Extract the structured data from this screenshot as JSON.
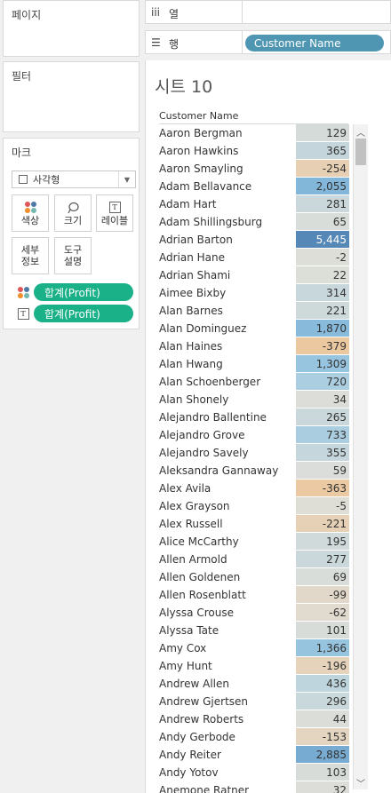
{
  "panels": {
    "pages": "페이지",
    "filters": "필터",
    "marks": "마크"
  },
  "marks_card": {
    "mark_type": "사각형",
    "buttons": {
      "color": "색상",
      "size": "크기",
      "label": "레이블",
      "detail": "세부\n정보",
      "tooltip": "도구\n설명"
    },
    "fields": [
      "합계(Profit)",
      "합계(Profit)"
    ]
  },
  "shelves": {
    "columns_label": "열",
    "rows_label": "행",
    "rows_pill": "Customer Name"
  },
  "sheet": {
    "title": "시트 10",
    "column_header": "Customer Name",
    "rows": [
      {
        "name": "Aaron Bergman",
        "value": "129"
      },
      {
        "name": "Aaron Hawkins",
        "value": "365"
      },
      {
        "name": "Aaron Smayling",
        "value": "-254"
      },
      {
        "name": "Adam Bellavance",
        "value": "2,055"
      },
      {
        "name": "Adam Hart",
        "value": "281"
      },
      {
        "name": "Adam Shillingsburg",
        "value": "65"
      },
      {
        "name": "Adrian Barton",
        "value": "5,445"
      },
      {
        "name": "Adrian Hane",
        "value": "-2"
      },
      {
        "name": "Adrian Shami",
        "value": "22"
      },
      {
        "name": "Aimee Bixby",
        "value": "314"
      },
      {
        "name": "Alan Barnes",
        "value": "221"
      },
      {
        "name": "Alan Dominguez",
        "value": "1,870"
      },
      {
        "name": "Alan Haines",
        "value": "-379"
      },
      {
        "name": "Alan Hwang",
        "value": "1,309"
      },
      {
        "name": "Alan Schoenberger",
        "value": "720"
      },
      {
        "name": "Alan Shonely",
        "value": "34"
      },
      {
        "name": "Alejandro Ballentine",
        "value": "265"
      },
      {
        "name": "Alejandro Grove",
        "value": "733"
      },
      {
        "name": "Alejandro Savely",
        "value": "355"
      },
      {
        "name": "Aleksandra Gannaway",
        "value": "59"
      },
      {
        "name": "Alex Avila",
        "value": "-363"
      },
      {
        "name": "Alex Grayson",
        "value": "-5"
      },
      {
        "name": "Alex Russell",
        "value": "-221"
      },
      {
        "name": "Alice McCarthy",
        "value": "195"
      },
      {
        "name": "Allen Armold",
        "value": "277"
      },
      {
        "name": "Allen Goldenen",
        "value": "69"
      },
      {
        "name": "Allen Rosenblatt",
        "value": "-99"
      },
      {
        "name": "Alyssa Crouse",
        "value": "-62"
      },
      {
        "name": "Alyssa Tate",
        "value": "101"
      },
      {
        "name": "Amy Cox",
        "value": "1,366"
      },
      {
        "name": "Amy Hunt",
        "value": "-196"
      },
      {
        "name": "Andrew Allen",
        "value": "436"
      },
      {
        "name": "Andrew Gjertsen",
        "value": "296"
      },
      {
        "name": "Andrew Roberts",
        "value": "44"
      },
      {
        "name": "Andy Gerbode",
        "value": "-153"
      },
      {
        "name": "Andy Reiter",
        "value": "2,885"
      },
      {
        "name": "Andy Yotov",
        "value": "103"
      },
      {
        "name": "Anemone Ratner",
        "value": "32"
      }
    ]
  },
  "icons": {
    "columns": "columns-icon",
    "rows": "rows-icon",
    "color": "color-dots-icon",
    "size": "size-lasso-icon",
    "label": "text-label-icon",
    "scroll_up": "chevron-up-icon",
    "scroll_down": "chevron-down-icon"
  },
  "colors": {
    "dimension_pill": "#4f96b3",
    "measure_pill": "#1ab188",
    "dots": [
      "#e15759",
      "#4e79a7",
      "#f28e2b",
      "#76b7b2"
    ]
  }
}
